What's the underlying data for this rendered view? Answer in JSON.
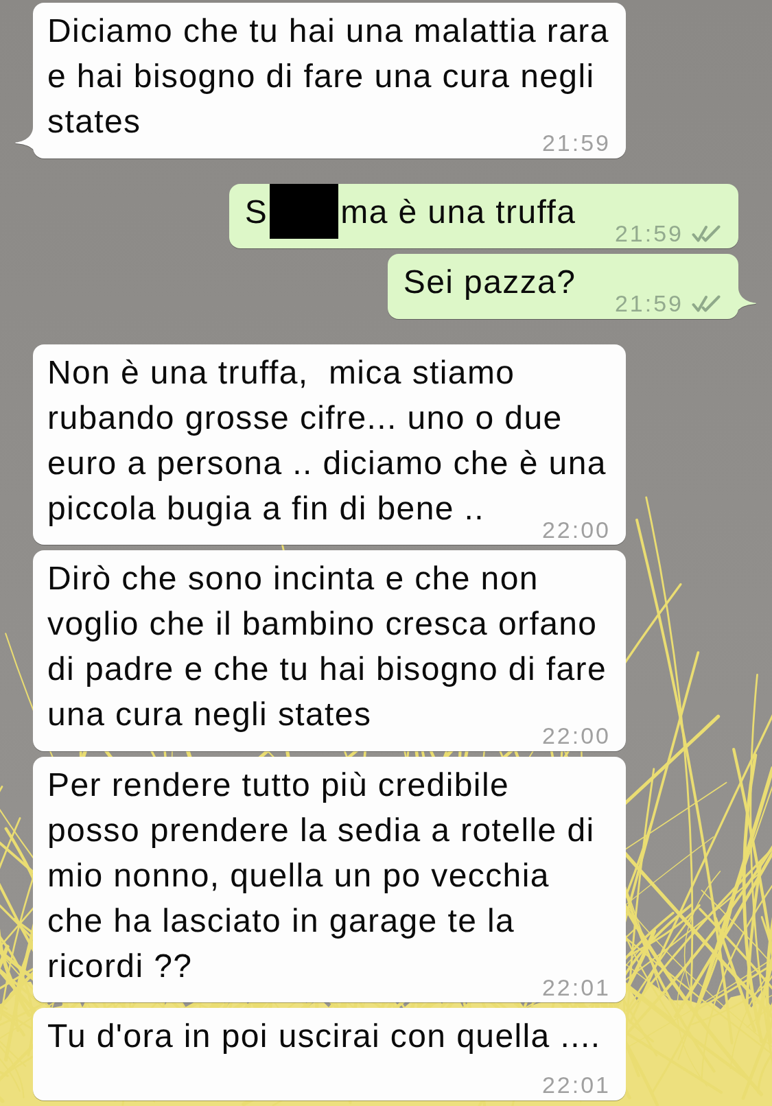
{
  "messages": [
    {
      "kind": "incoming",
      "tail": true,
      "parts": [
        {
          "kind": "text",
          "text": "Diciamo che tu hai una malattia rara e hai bisogno di fare una cura negli states"
        }
      ],
      "time": "21:59"
    },
    {
      "kind": "outgoing",
      "tail": false,
      "parts": [
        {
          "kind": "text",
          "text": "S"
        },
        {
          "kind": "redaction"
        },
        {
          "kind": "text",
          "text": "ma è una truffa"
        }
      ],
      "time": "21:59",
      "delivered": true,
      "read": false
    },
    {
      "kind": "outgoing",
      "tail": true,
      "parts": [
        {
          "kind": "text",
          "text": "Sei pazza?"
        }
      ],
      "time": "21:59",
      "delivered": true,
      "read": false
    },
    {
      "kind": "incoming",
      "tail": false,
      "parts": [
        {
          "kind": "text",
          "text": "Non è una truffa,  mica stiamo rubando grosse cifre... uno o due euro a persona .. diciamo che è una piccola bugia a fin di bene .."
        }
      ],
      "time": "22:00"
    },
    {
      "kind": "incoming",
      "tail": false,
      "parts": [
        {
          "kind": "text",
          "text": "Dirò che sono incinta e che non voglio che il bambino cresca orfano di padre e che tu hai bisogno di fare una cura negli states"
        }
      ],
      "time": "22:00"
    },
    {
      "kind": "incoming",
      "tail": false,
      "parts": [
        {
          "kind": "text",
          "text": "Per rendere tutto più credibile\nposso prendere la sedia a rotelle di mio nonno, quella un po vecchia che ha lasciato in garage te la ricordi ??"
        }
      ],
      "time": "22:01"
    },
    {
      "kind": "incoming",
      "tail": false,
      "parts": [
        {
          "kind": "text",
          "text": "Tu d'ora in poi uscirai con quella ...."
        }
      ],
      "time": "22:01"
    }
  ]
}
